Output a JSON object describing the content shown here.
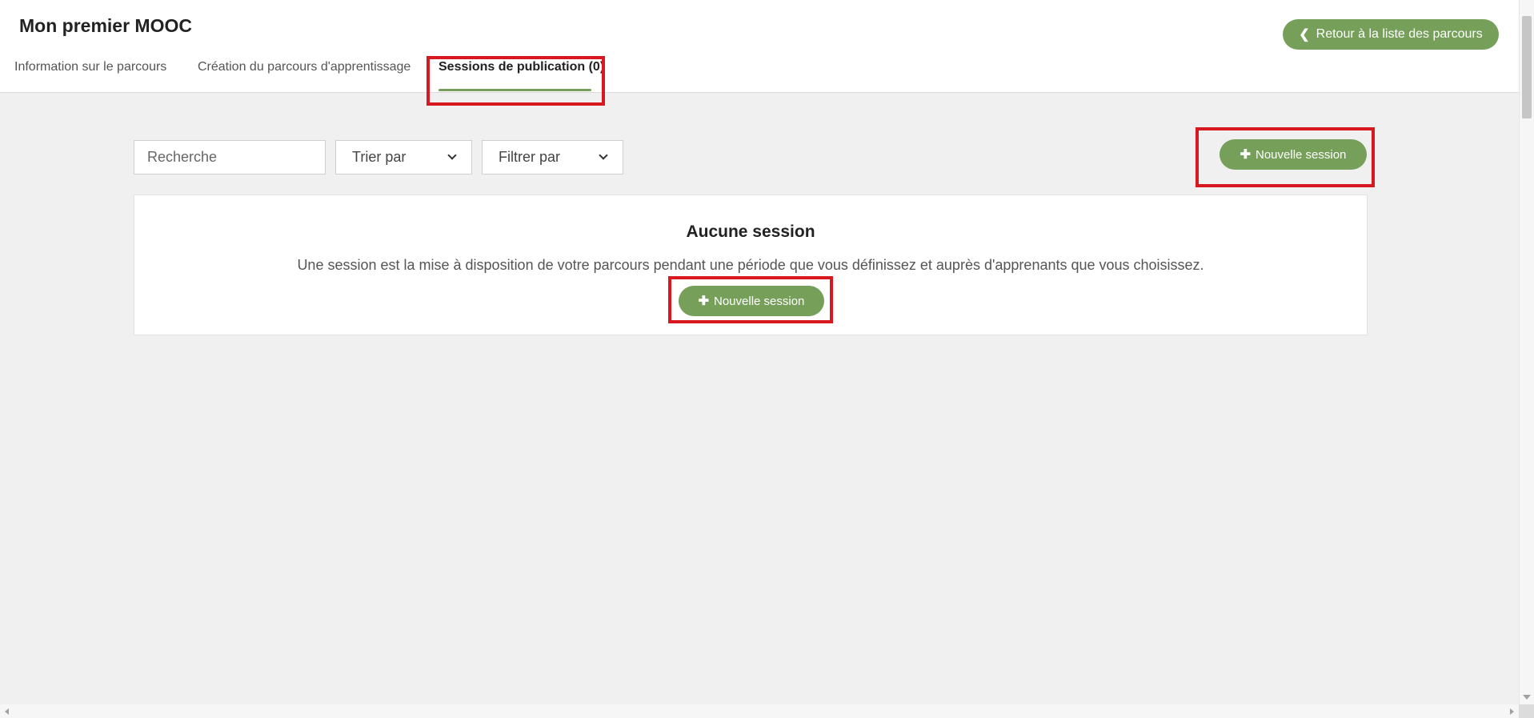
{
  "header": {
    "course_title": "Mon premier MOOC",
    "back_button_label": "Retour à la liste des parcours",
    "back_icon": "chevron-left-icon",
    "tabs": [
      {
        "label": "Information sur le parcours",
        "active": false
      },
      {
        "label": "Création du parcours d'apprentissage",
        "active": false
      },
      {
        "label": "Sessions de publication (0)",
        "active": true
      }
    ]
  },
  "toolbar": {
    "search_placeholder": "Recherche",
    "sort_label": "Trier par",
    "filter_label": "Filtrer par",
    "new_session_label": "Nouvelle session",
    "plus_icon": "plus-icon"
  },
  "empty_state": {
    "title": "Aucune session",
    "description": "Une session est la mise à disposition de votre parcours pendant une période que vous définissez et auprès d'apprenants que vous choisissez.",
    "new_session_label": "Nouvelle session"
  },
  "colors": {
    "accent": "#76a05a",
    "highlight": "#d7191f",
    "background": "#f0f0f0"
  }
}
